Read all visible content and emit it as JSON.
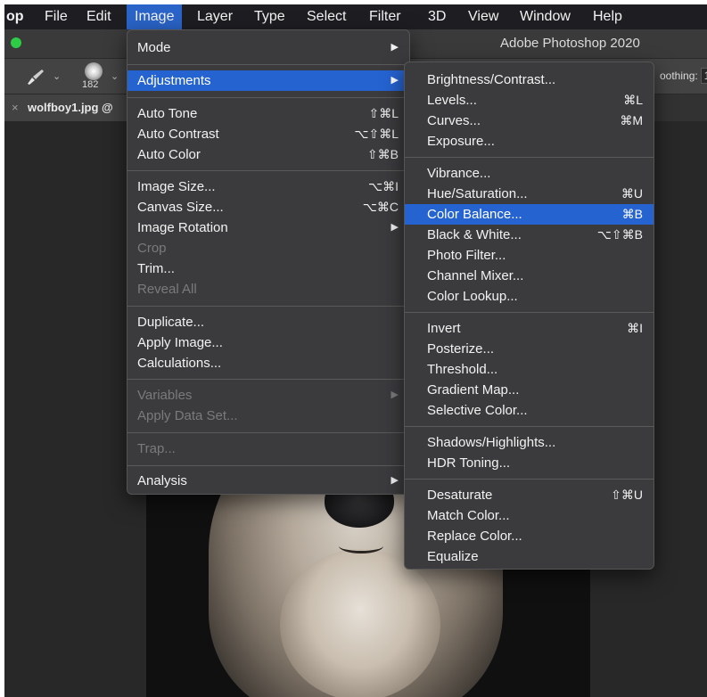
{
  "menubar": {
    "app": "op",
    "items": [
      "File",
      "Edit",
      "Image",
      "Layer",
      "Type",
      "Select",
      "Filter",
      "3D",
      "View",
      "Window",
      "Help"
    ]
  },
  "window": {
    "title": "Adobe Photoshop 2020"
  },
  "options_bar": {
    "brush_size": "182",
    "smoothing_label": "oothing:",
    "smoothing_value": "1"
  },
  "document_tab": {
    "close": "×",
    "title": "wolfboy1.jpg @"
  },
  "image_menu": {
    "items": [
      {
        "label": "Mode",
        "arrow": "▶"
      },
      {
        "label": "Adjustments",
        "arrow": "▶"
      },
      {
        "label": "Auto Tone",
        "shortcut": "⇧⌘L"
      },
      {
        "label": "Auto Contrast",
        "shortcut": "⌥⇧⌘L"
      },
      {
        "label": "Auto Color",
        "shortcut": "⇧⌘B"
      },
      {
        "label": "Image Size...",
        "shortcut": "⌥⌘I"
      },
      {
        "label": "Canvas Size...",
        "shortcut": "⌥⌘C"
      },
      {
        "label": "Image Rotation",
        "arrow": "▶"
      },
      {
        "label": "Crop"
      },
      {
        "label": "Trim..."
      },
      {
        "label": "Reveal All"
      },
      {
        "label": "Duplicate..."
      },
      {
        "label": "Apply Image..."
      },
      {
        "label": "Calculations..."
      },
      {
        "label": "Variables",
        "arrow": "▶"
      },
      {
        "label": "Apply Data Set..."
      },
      {
        "label": "Trap..."
      },
      {
        "label": "Analysis",
        "arrow": "▶"
      }
    ]
  },
  "adjustments_menu": {
    "items": [
      {
        "label": "Brightness/Contrast..."
      },
      {
        "label": "Levels...",
        "shortcut": "⌘L"
      },
      {
        "label": "Curves...",
        "shortcut": "⌘M"
      },
      {
        "label": "Exposure..."
      },
      {
        "label": "Vibrance..."
      },
      {
        "label": "Hue/Saturation...",
        "shortcut": "⌘U"
      },
      {
        "label": "Color Balance...",
        "shortcut": "⌘B"
      },
      {
        "label": "Black & White...",
        "shortcut": "⌥⇧⌘B"
      },
      {
        "label": "Photo Filter..."
      },
      {
        "label": "Channel Mixer..."
      },
      {
        "label": "Color Lookup..."
      },
      {
        "label": "Invert",
        "shortcut": "⌘I"
      },
      {
        "label": "Posterize..."
      },
      {
        "label": "Threshold..."
      },
      {
        "label": "Gradient Map..."
      },
      {
        "label": "Selective Color..."
      },
      {
        "label": "Shadows/Highlights..."
      },
      {
        "label": "HDR Toning..."
      },
      {
        "label": "Desaturate",
        "shortcut": "⇧⌘U"
      },
      {
        "label": "Match Color..."
      },
      {
        "label": "Replace Color..."
      },
      {
        "label": "Equalize"
      }
    ]
  },
  "colors": {
    "highlight": "#2563d1",
    "menu_bg": "#3b3b3e",
    "menubar_bg": "#1e1e22"
  }
}
